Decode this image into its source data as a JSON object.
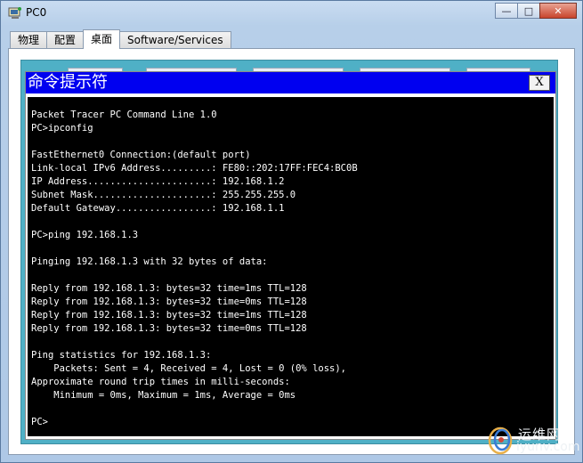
{
  "window": {
    "title": "PC0",
    "controls": {
      "minimize": "—",
      "maximize": "□",
      "close": "✕"
    }
  },
  "tabs": [
    {
      "label": "物理",
      "active": false
    },
    {
      "label": "配置",
      "active": false
    },
    {
      "label": "桌面",
      "active": true
    },
    {
      "label": "Software/Services",
      "active": false
    }
  ],
  "cmd_window": {
    "title": "命令提示符",
    "close_label": "X"
  },
  "terminal": {
    "lines": [
      "Packet Tracer PC Command Line 1.0",
      "PC>ipconfig",
      "",
      "FastEthernet0 Connection:(default port)",
      "Link-local IPv6 Address.........: FE80::202:17FF:FEC4:BC0B",
      "IP Address......................: 192.168.1.2",
      "Subnet Mask.....................: 255.255.255.0",
      "Default Gateway.................: 192.168.1.1",
      "",
      "PC>ping 192.168.1.3",
      "",
      "Pinging 192.168.1.3 with 32 bytes of data:",
      "",
      "Reply from 192.168.1.3: bytes=32 time=1ms TTL=128",
      "Reply from 192.168.1.3: bytes=32 time=0ms TTL=128",
      "Reply from 192.168.1.3: bytes=32 time=1ms TTL=128",
      "Reply from 192.168.1.3: bytes=32 time=0ms TTL=128",
      "",
      "Ping statistics for 192.168.1.3:",
      "    Packets: Sent = 4, Received = 4, Lost = 0 (0% loss),",
      "Approximate round trip times in milli-seconds:",
      "    Minimum = 0ms, Maximum = 1ms, Average = 0ms",
      "",
      "PC>"
    ]
  },
  "watermark": {
    "cn_text": "运维网",
    "url": "iyunv.com"
  },
  "colors": {
    "cmd_title_bg": "#0000f0",
    "terminal_bg": "#000000",
    "terminal_fg": "#ffffff",
    "desktop_bg": "#4fb0c6"
  }
}
